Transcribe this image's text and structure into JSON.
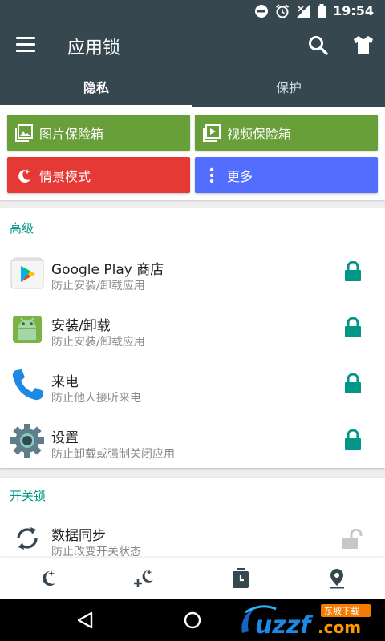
{
  "status_bar": {
    "time": "19:54",
    "icons": [
      "dnd-icon",
      "alarm-icon",
      "signal-icon",
      "battery-icon"
    ]
  },
  "app_bar": {
    "title": "应用锁",
    "icons": [
      "menu-icon",
      "search-icon",
      "theme-shirt-icon"
    ]
  },
  "tabs": [
    {
      "label": "隐私",
      "active": true
    },
    {
      "label": "保护",
      "active": false
    }
  ],
  "quick_actions": [
    {
      "label": "图片保险箱",
      "icon": "photo-vault-icon",
      "color": "#689f38"
    },
    {
      "label": "视频保险箱",
      "icon": "video-vault-icon",
      "color": "#689f38"
    },
    {
      "label": "情景模式",
      "icon": "scene-mode-icon",
      "color": "#e53935"
    },
    {
      "label": "更多",
      "icon": "more-vert-icon",
      "color": "#536dfe"
    }
  ],
  "advanced": {
    "header": "高级",
    "items": [
      {
        "title": "Google Play 商店",
        "subtitle": "防止安装/卸载应用",
        "icon": "google-play-icon",
        "locked": true
      },
      {
        "title": "安装/卸载",
        "subtitle": "防止安装/卸载应用",
        "icon": "android-icon",
        "locked": true
      },
      {
        "title": "来电",
        "subtitle": "防止他人接听来电",
        "icon": "phone-icon",
        "locked": true
      },
      {
        "title": "设置",
        "subtitle": "防止卸载或强制关闭应用",
        "icon": "settings-gear-icon",
        "locked": true
      }
    ]
  },
  "switch_lock": {
    "header": "开关锁",
    "items": [
      {
        "title": "数据同步",
        "subtitle": "防止改变开关状态",
        "icon": "sync-icon",
        "locked": false
      }
    ]
  },
  "bottom_nav": [
    "night-mode-icon",
    "add-night-mode-icon",
    "timer-lock-icon",
    "location-lock-icon"
  ],
  "colors": {
    "appbar": "#37474f",
    "accent": "#009688",
    "lock": "#009688"
  },
  "watermark": {
    "text": "uzzf.com",
    "badge": "东坡下载"
  }
}
